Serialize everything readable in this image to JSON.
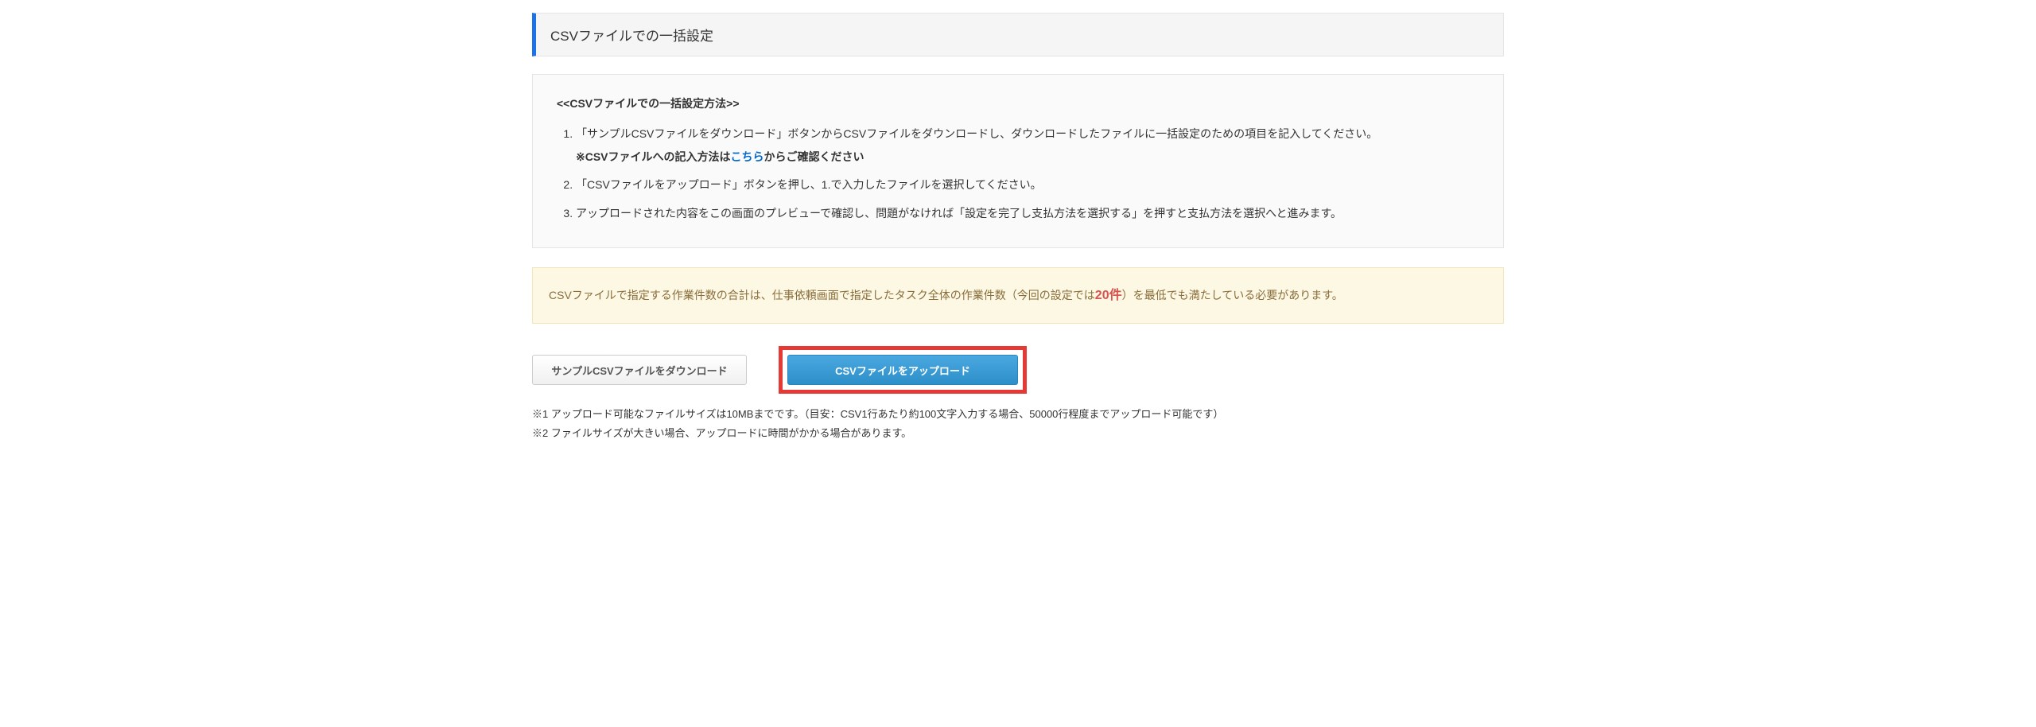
{
  "header": {
    "title": "CSVファイルでの一括設定"
  },
  "instructions": {
    "title": "<<CSVファイルでの一括設定方法>>",
    "step1": "「サンプルCSVファイルをダウンロード」ボタンからCSVファイルをダウンロードし、ダウンロードしたファイルに一括設定のための項目を記入してください。",
    "step1_note_prefix": "※CSVファイルへの記入方法は",
    "step1_note_link": "こちら",
    "step1_note_suffix": "からご確認ください",
    "step2": "「CSVファイルをアップロード」ボタンを押し、1.で入力したファイルを選択してください。",
    "step3": "アップロードされた内容をこの画面のプレビューで確認し、問題がなければ「設定を完了し支払方法を選択する」を押すと支払方法を選択へと進みます。"
  },
  "warning": {
    "prefix": "CSVファイルで指定する作業件数の合計は、仕事依頼画面で指定したタスク全体の作業件数（今回の設定では",
    "count": "20件",
    "suffix": "）を最低でも満たしている必要があります。"
  },
  "buttons": {
    "download": "サンプルCSVファイルをダウンロード",
    "upload": "CSVファイルをアップロード"
  },
  "footnotes": {
    "note1": "※1 アップロード可能なファイルサイズは10MBまでです。（目安：CSV1行あたり約100文字入力する場合、50000行程度までアップロード可能です）",
    "note2": "※2 ファイルサイズが大きい場合、アップロードに時間がかかる場合があります。"
  }
}
